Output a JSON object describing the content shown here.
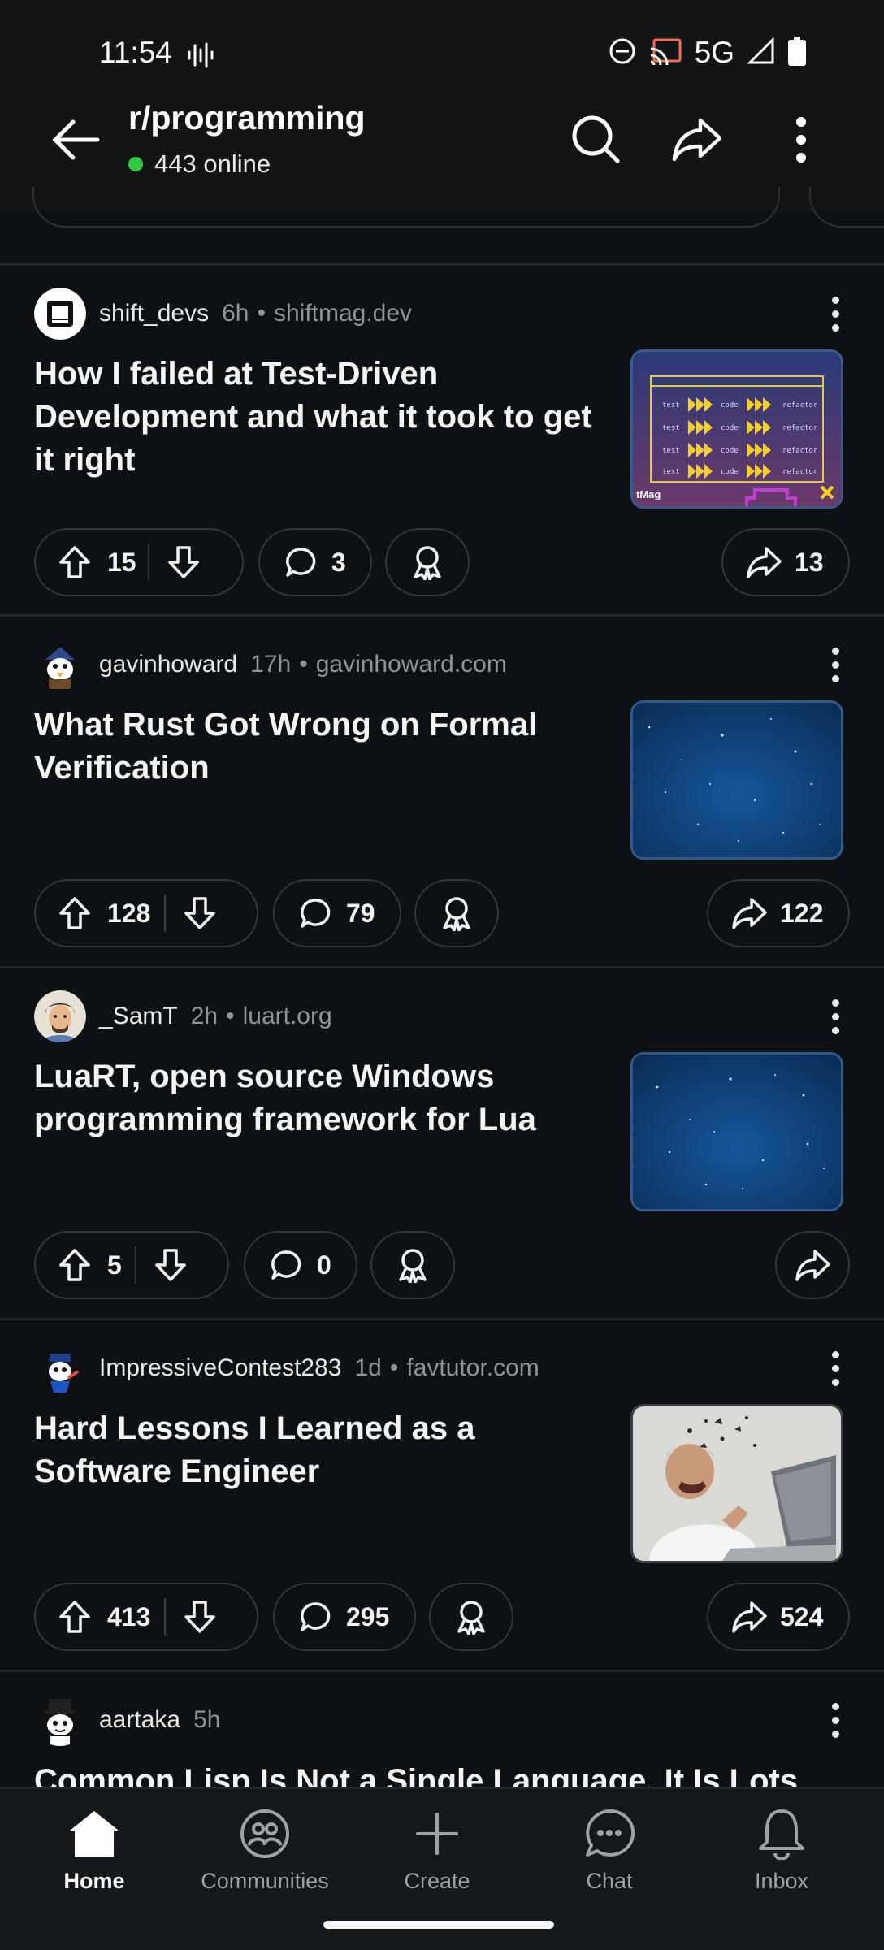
{
  "status_bar": {
    "time": "11:54",
    "network": "5G"
  },
  "header": {
    "subreddit": "r/programming",
    "online": "443 online"
  },
  "posts": [
    {
      "author": "shift_devs",
      "age": "6h",
      "domain": "shiftmag.dev",
      "title": "How I failed at Test-Driven Development and what it took to get it right",
      "upvotes": "15",
      "comments": "3",
      "shares": "13",
      "thumb": "tdd",
      "thumb_label": "tMag",
      "thumb_rows": [
        "test",
        "code",
        "refactor"
      ]
    },
    {
      "author": "gavinhoward",
      "age": "17h",
      "domain": "gavinhoward.com",
      "title": "What Rust Got Wrong on Formal Verification",
      "upvotes": "128",
      "comments": "79",
      "shares": "122",
      "thumb": "stars"
    },
    {
      "author": "_SamT",
      "age": "2h",
      "domain": "luart.org",
      "title": "LuaRT, open source Windows programming framework for Lua",
      "upvotes": "5",
      "comments": "0",
      "shares": "",
      "thumb": "stars"
    },
    {
      "author": "ImpressiveContest283",
      "age": "1d",
      "domain": "favtutor.com",
      "title": "Hard Lessons I Learned as a Software Engineer",
      "upvotes": "413",
      "comments": "295",
      "shares": "524",
      "thumb": "photo"
    },
    {
      "author": "aartaka",
      "age": "5h",
      "domain": "",
      "title": "Common Lisp Is Not a Single Language, It Is Lots",
      "upvotes": "",
      "comments": "",
      "shares": "",
      "thumb": ""
    }
  ],
  "nav": [
    {
      "label": "Home",
      "icon": "home-icon",
      "active": true
    },
    {
      "label": "Communities",
      "icon": "communities-icon",
      "active": false
    },
    {
      "label": "Create",
      "icon": "plus-icon",
      "active": false
    },
    {
      "label": "Chat",
      "icon": "chat-icon",
      "active": false
    },
    {
      "label": "Inbox",
      "icon": "bell-icon",
      "active": false
    }
  ],
  "colors": {
    "background": "#0e1113",
    "online_dot": "#2ecc40",
    "thumb_border": "#2f5a8a"
  }
}
